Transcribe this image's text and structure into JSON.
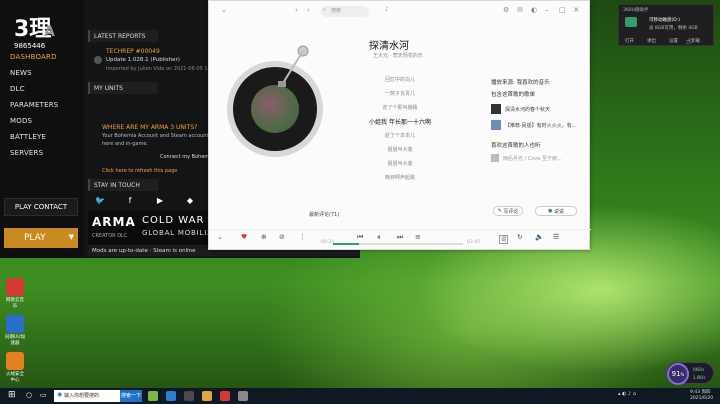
{
  "recorder": {
    "label": "00:00"
  },
  "launcher": {
    "logo_text": "3理",
    "user_id": "9865446",
    "nav": [
      "DASHBOARD",
      "NEWS",
      "DLC",
      "PARAMETERS",
      "MODS",
      "BATTLEYE",
      "SERVERS"
    ],
    "contact_label": "PLAY CONTACT",
    "play_label": "PLAY",
    "reports_header": "LATEST REPORTS",
    "report": {
      "title": "TECHREP #00049",
      "line": "Update 1.028.1 (Publisher)",
      "meta": "Imported by Julien Vida on 2021-06-05 13:31"
    },
    "units_header": "MY UNITS",
    "units_q": "WHERE ARE MY ARMA 3 UNITS?",
    "units_t1": "Your Bohemia Account and Steam account have to be linked before you",
    "units_t2": "here and in-game.",
    "units_connect": "Connect my Bohemia",
    "units_click": "Click here to refresh this page",
    "stay_header": "STAY IN TOUCH",
    "social": [
      "twitter-icon",
      "facebook-icon",
      "youtube-icon",
      "bohemia-icon"
    ],
    "social_glyph": [
      "🐦",
      "f",
      "▶",
      "◆"
    ],
    "banner_logo": "ARMA",
    "banner_logo_sub": "CREATOR DLC",
    "banner_title": "COLD WAR G",
    "banner_sub": "GLOBAL MOBILIZATI",
    "status": "Mods are up-to-date · Steam is online"
  },
  "music": {
    "search_placeholder": "搜索",
    "title": "探清水河",
    "subtitle": "王大元 · 悲天悯花的乐",
    "lyrics": [
      "回忆中的鸟儿",
      "一窝子瓦青儿",
      "走了个那叫棚路",
      "小姐我 年长那一十六啊",
      "赶了个本本儿",
      "姐姐叫大莲",
      "姐姐叫大莲",
      "晚钟啊声起跳"
    ],
    "current_lyric_index": 3,
    "right": {
      "h1": "播放来源: 我喜欢的音乐",
      "h2": "包含这首歌的歌单",
      "pl1": "探清水河的春个秋天",
      "pl2": "【推荐·民谣】有时火火火，有...",
      "h3": "喜欢这首歌的人也听",
      "s1": "雨后月光 / Cove 至于雨..."
    },
    "btn_write": "写评论",
    "btn_talk": "说说",
    "comments": "最新评论(71)",
    "time_cur": "00:33",
    "time_total": "03:45",
    "progress": 0.2,
    "lyric_btn": "词"
  },
  "desktop": [
    {
      "label": "网易云音乐",
      "color": "#d33a31"
    },
    {
      "label": "同期UU加速器",
      "color": "#2a6ec9"
    },
    {
      "label": "火绒安全中心",
      "color": "#e67e22"
    }
  ],
  "notify": {
    "title": "360U盘助手",
    "l1": "可移动磁盘(D:)",
    "l2": "总 8GB可用，剩余 4GB",
    "b1": "打开",
    "b2": "弹出",
    "b3": "设置",
    "b4": "卸载"
  },
  "gauge": {
    "value": "91",
    "up": "0KB/s",
    "down": "1.0K/s",
    "unit": "%"
  },
  "taskbar": {
    "search": "输入你想要搜的",
    "search_btn": "搜索一下",
    "time": "9:43 周四",
    "date": "2021/6/20"
  }
}
